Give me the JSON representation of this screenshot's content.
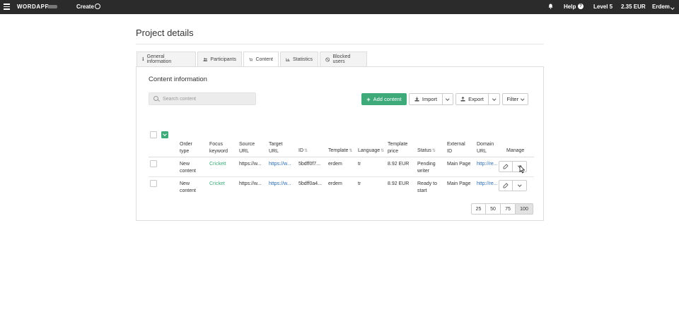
{
  "topbar": {
    "logo": "WORDAPP",
    "create_label": "Create",
    "help_label": "Help",
    "level_label": "Level 5",
    "balance": "2.35 EUR",
    "user_name": "Erdem"
  },
  "page": {
    "title": "Project details"
  },
  "tabs": [
    {
      "label": "General information",
      "icon": "info-icon"
    },
    {
      "label": "Participants",
      "icon": "users-icon"
    },
    {
      "label": "Content",
      "icon": "cart-icon",
      "active": true
    },
    {
      "label": "Statistics",
      "icon": "bar-chart-icon"
    },
    {
      "label": "Blocked users",
      "icon": "blocked-icon"
    }
  ],
  "content": {
    "title": "Content information",
    "search_placeholder": "Search content",
    "add_content_label": "Add content",
    "import_label": "Import",
    "export_label": "Export",
    "filter_label": "Filter"
  },
  "table": {
    "headers": {
      "order_type": [
        "Order",
        "type"
      ],
      "focus_keyword": [
        "Focus",
        "keyword"
      ],
      "source_url": [
        "Source",
        "URL"
      ],
      "target_url": [
        "Target",
        "URL"
      ],
      "id": "ID",
      "template": "Template",
      "language": "Language",
      "template_price": [
        "Template",
        "price"
      ],
      "status": "Status",
      "external_id": [
        "External",
        "ID"
      ],
      "domain_url": [
        "Domain",
        "URL"
      ],
      "manage": "Manage"
    },
    "rows": [
      {
        "order_type": [
          "New",
          "content"
        ],
        "focus_keyword": "Crickett",
        "source_url": "https://w...",
        "target_url": "https://w...",
        "id": "5bdff0f7...",
        "template": "erdem",
        "language": "tr",
        "template_price": "8.92 EUR",
        "status": [
          "Pending",
          "writer"
        ],
        "external_id": "Main Page",
        "domain_url": "http://re..."
      },
      {
        "order_type": [
          "New",
          "content"
        ],
        "focus_keyword": "Cricket",
        "source_url": "https://w...",
        "target_url": "https://w...",
        "id": "5bdff0a4...",
        "template": "erdem",
        "language": "tr",
        "template_price": "8.92 EUR",
        "status": [
          "Ready to",
          "start"
        ],
        "external_id": "Main Page",
        "domain_url": "http://re..."
      }
    ]
  },
  "pagination": {
    "sizes": [
      "25",
      "50",
      "75",
      "100"
    ],
    "active": "100"
  },
  "colors": {
    "accent": "#3eaa7a",
    "topbar": "#2b2b2b",
    "link": "#2a6cb0"
  }
}
